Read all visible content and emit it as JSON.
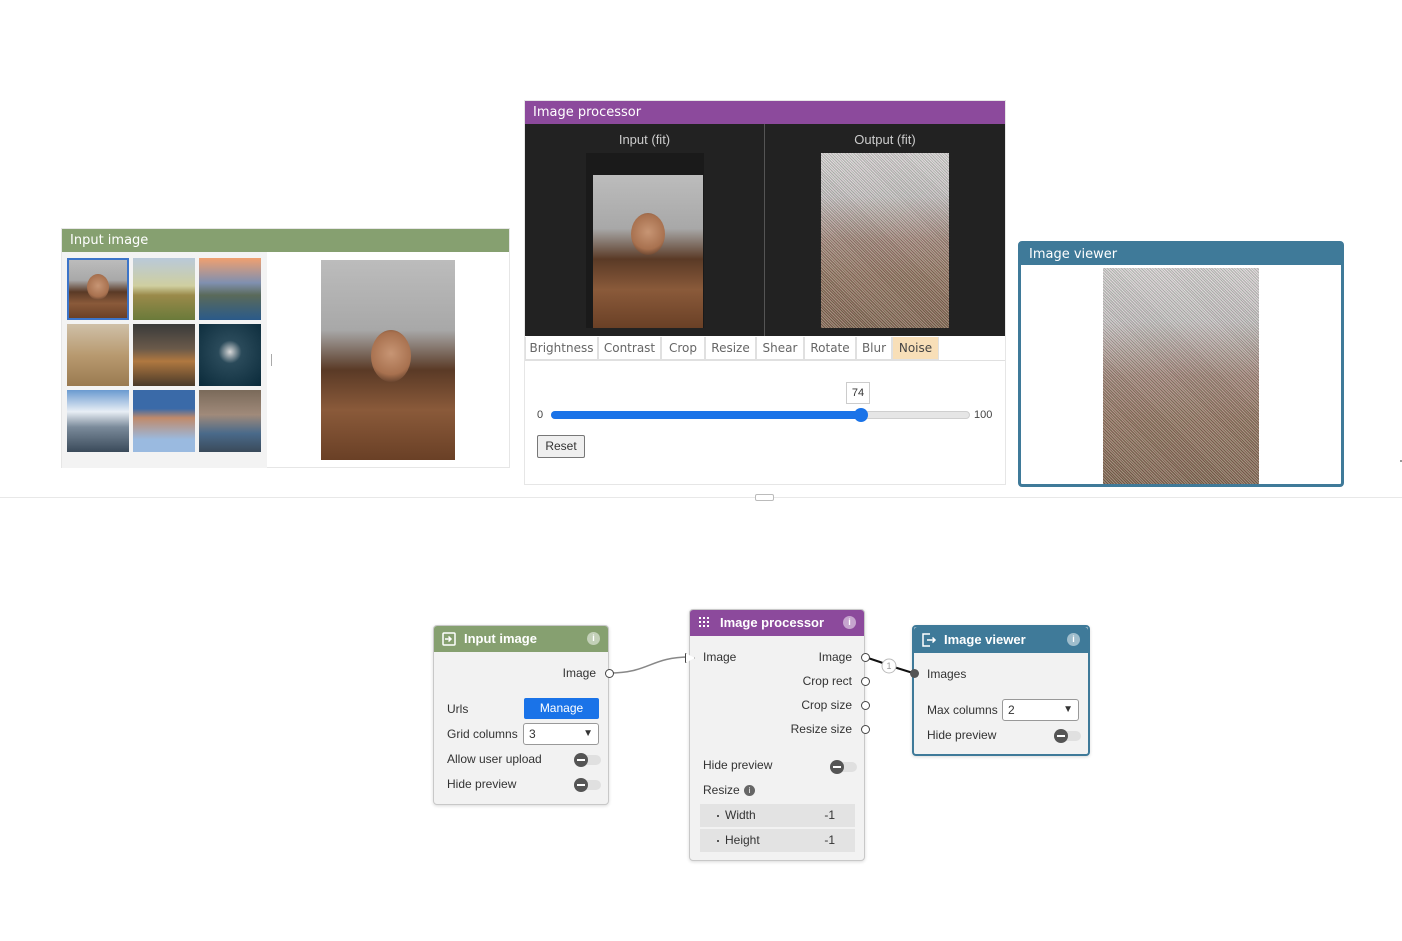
{
  "panels": {
    "input_image": {
      "title": "Input image"
    },
    "image_processor": {
      "title": "Image processor",
      "input_label": "Input (fit)",
      "output_label": "Output (fit)",
      "tabs": [
        "Brightness",
        "Contrast",
        "Crop",
        "Resize",
        "Shear",
        "Rotate",
        "Blur",
        "Noise"
      ],
      "active_tab": "Noise",
      "slider": {
        "min": "0",
        "max": "100",
        "value": "74",
        "fraction": 0.74
      },
      "reset_label": "Reset"
    },
    "image_viewer": {
      "title": "Image viewer"
    }
  },
  "nodes": {
    "input_image": {
      "title": "Input image",
      "output_label": "Image",
      "urls_label": "Urls",
      "manage_label": "Manage",
      "grid_columns_label": "Grid columns",
      "grid_columns_value": "3",
      "allow_upload_label": "Allow user upload",
      "hide_preview_label": "Hide preview"
    },
    "image_processor": {
      "title": "Image processor",
      "input_label": "Image",
      "outputs": [
        "Image",
        "Crop rect",
        "Crop size",
        "Resize size"
      ],
      "hide_preview_label": "Hide preview",
      "resize_label": "Resize",
      "width_label": "Width",
      "width_value": "-1",
      "height_label": "Height",
      "height_value": "-1"
    },
    "image_viewer": {
      "title": "Image viewer",
      "input_label": "Images",
      "max_columns_label": "Max columns",
      "max_columns_value": "2",
      "hide_preview_label": "Hide preview"
    }
  },
  "connection_badge": "1",
  "colors": {
    "input_green": "#86a070",
    "processor_purple": "#8c4a9c",
    "viewer_blue": "#3f7a99",
    "accent_blue": "#1a73e8",
    "active_tab": "#f8dfb8"
  }
}
